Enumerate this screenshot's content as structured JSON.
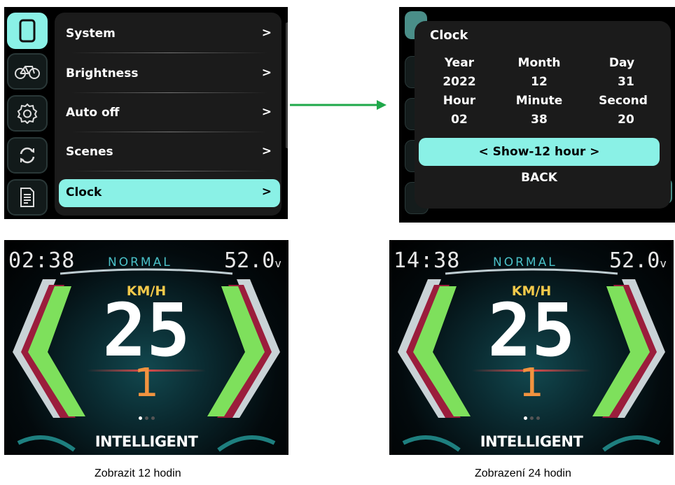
{
  "settings_menu": {
    "side_icons": [
      "phone-icon",
      "bicycle-icon",
      "gear-icon",
      "refresh-icon",
      "document-icon"
    ],
    "items": [
      {
        "label": "System",
        "arrow": ">"
      },
      {
        "label": "Brightness",
        "arrow": ">"
      },
      {
        "label": "Auto off",
        "arrow": ">"
      },
      {
        "label": "Scenes",
        "arrow": ">"
      },
      {
        "label": "Clock",
        "arrow": ">"
      }
    ],
    "selected": "Clock"
  },
  "clock_dialog": {
    "title": "Clock",
    "labels": {
      "year": "Year",
      "month": "Month",
      "day": "Day",
      "hour": "Hour",
      "minute": "Minute",
      "second": "Second"
    },
    "values": {
      "year": "2022",
      "month": "12",
      "day": "31",
      "hour": "02",
      "minute": "38",
      "second": "20"
    },
    "toggle": "< Show-12 hour >",
    "back": "BACK"
  },
  "arrow_color": "#1fa84a",
  "accent_color": "#8af1e6",
  "dash_12h": {
    "time": "02:38",
    "mode": "NORMAL",
    "voltage": "52.0",
    "voltage_unit": "v",
    "speed_unit": "KM/H",
    "speed": "25",
    "assist_level": "1",
    "profile": "INTELLIGENT"
  },
  "dash_24h": {
    "time": "14:38",
    "mode": "NORMAL",
    "voltage": "52.0",
    "voltage_unit": "v",
    "speed_unit": "KM/H",
    "speed": "25",
    "assist_level": "1",
    "profile": "INTELLIGENT"
  },
  "captions": {
    "left": "Zobrazit 12 hodin",
    "right": "Zobrazení 24 hodin"
  }
}
